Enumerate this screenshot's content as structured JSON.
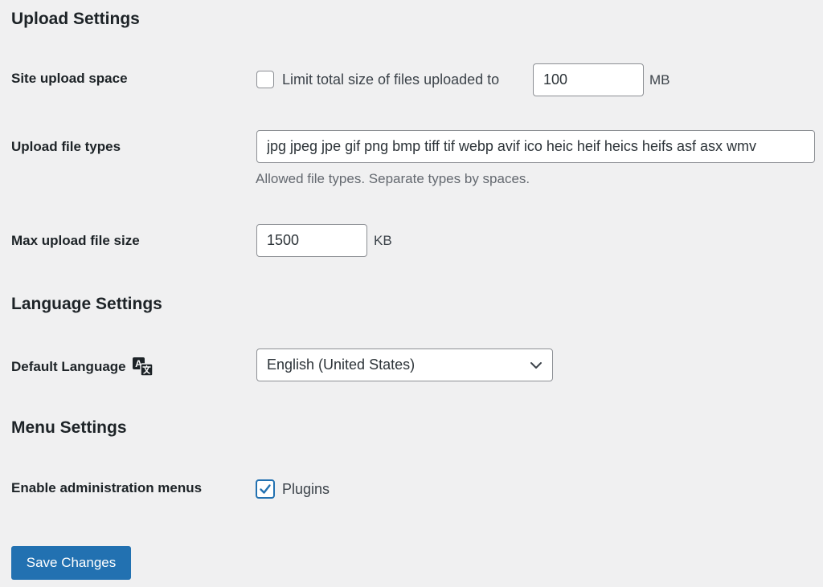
{
  "upload_settings": {
    "title": "Upload Settings",
    "site_upload_space": {
      "label": "Site upload space",
      "checkbox_label": "Limit total size of files uploaded to",
      "checked": false,
      "value": "100",
      "unit": "MB"
    },
    "upload_file_types": {
      "label": "Upload file types",
      "value": "jpg jpeg jpe gif png bmp tiff tif webp avif ico heic heif heics heifs asf asx wmv",
      "description": "Allowed file types. Separate types by spaces."
    },
    "max_upload_file_size": {
      "label": "Max upload file size",
      "value": "1500",
      "unit": "KB"
    }
  },
  "language_settings": {
    "title": "Language Settings",
    "default_language": {
      "label": "Default Language",
      "icon": "translation-icon",
      "selected": "English (United States)"
    }
  },
  "menu_settings": {
    "title": "Menu Settings",
    "enable_admin_menus": {
      "label": "Enable administration menus",
      "option_label": "Plugins",
      "checked": true
    }
  },
  "save_button": {
    "label": "Save Changes"
  },
  "colors": {
    "accent": "#2271b1",
    "background": "#f0f0f1",
    "text": "#1d2327",
    "muted_text": "#646970"
  }
}
